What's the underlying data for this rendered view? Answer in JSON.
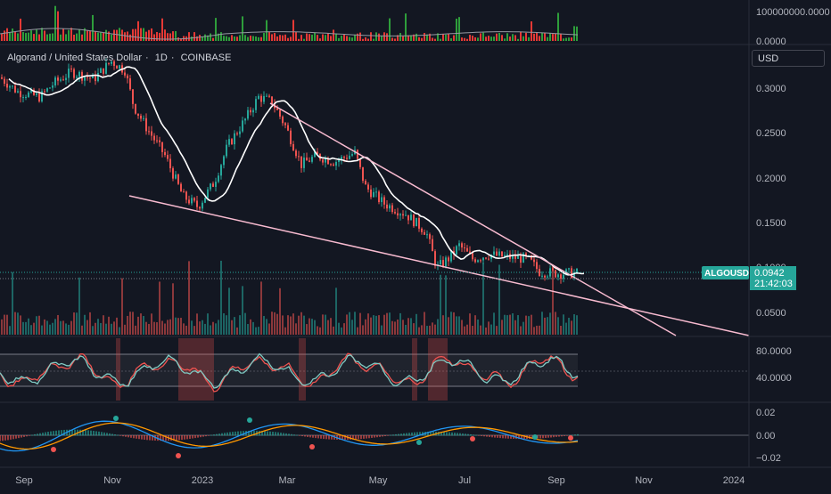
{
  "legend": {
    "symbol_name": "Algorand / United States Dollar",
    "interval": "1D",
    "exchange": "COINBASE"
  },
  "currency_button": "USD",
  "price_label": {
    "ticker": "ALGOUSD",
    "price": "0.0942",
    "countdown": "21:42:03",
    "color": "#26a69a"
  },
  "colors": {
    "background": "#131722",
    "up": "#26a69a",
    "down": "#ef5350",
    "trendline": "#f8bbd0",
    "moving_average": "#ffffff"
  },
  "price_axis": {
    "ticks": [
      "0.3000",
      "0.2500",
      "0.2000",
      "0.1500",
      "0.1000",
      "0.0500"
    ]
  },
  "top_volume_axis": {
    "ticks": [
      "100000000.0000",
      "0.0000"
    ]
  },
  "oscillator_axis": {
    "ticks": [
      "80.0000",
      "40.0000"
    ]
  },
  "macd_axis": {
    "ticks": [
      "0.02",
      "0.00",
      "−0.02"
    ]
  },
  "time_axis": {
    "labels": [
      "Sep",
      "Nov",
      "2023",
      "Mar",
      "May",
      "Jul",
      "Sep",
      "Nov",
      "2024"
    ]
  }
}
